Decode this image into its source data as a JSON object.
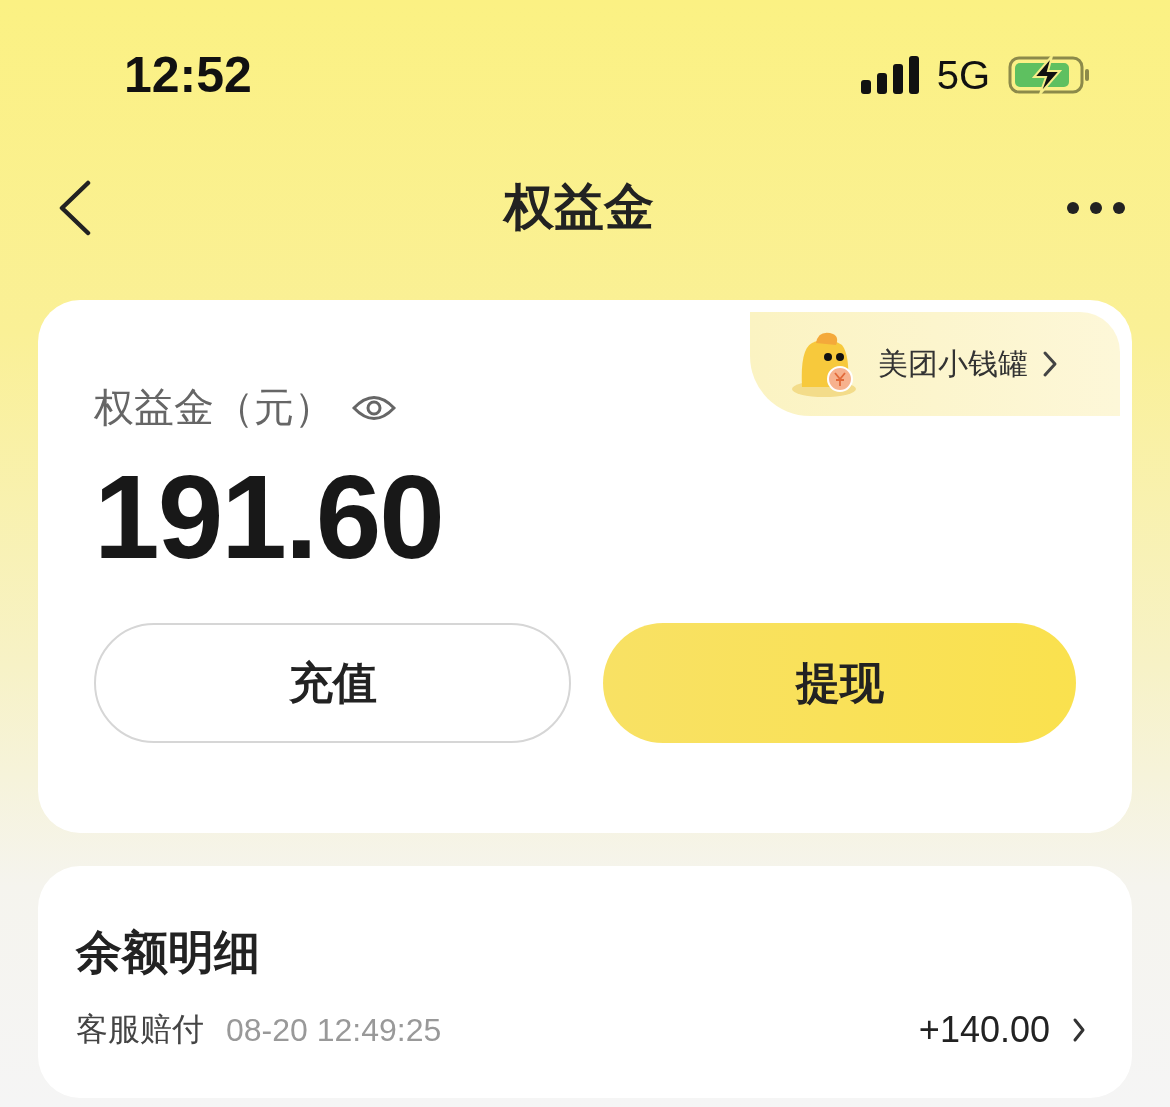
{
  "status_bar": {
    "time": "12:52",
    "network": "5G"
  },
  "nav_bar": {
    "title": "权益金"
  },
  "balance_card": {
    "label": "权益金（元）",
    "amount": "191.60",
    "piggy_bank_link": "美团小钱罐",
    "buttons": [
      {
        "label": "充值",
        "kind": "outline"
      },
      {
        "label": "提现",
        "kind": "primary"
      }
    ]
  },
  "details": {
    "title": "余额明细",
    "records": [
      {
        "source": "客服赔付",
        "time": "08-20 12:49:25",
        "amount": "+140.00"
      }
    ]
  }
}
